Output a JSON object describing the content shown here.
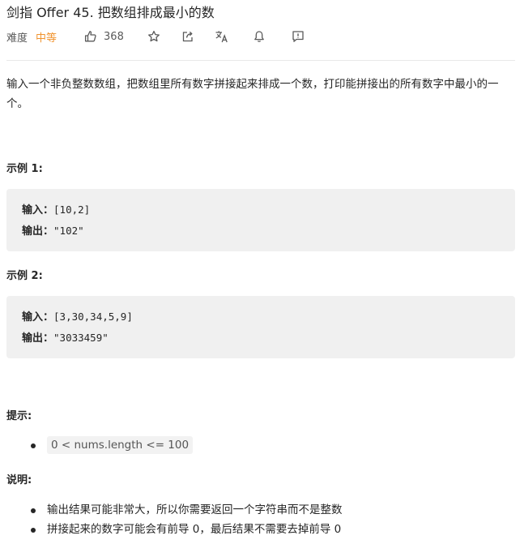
{
  "problem": {
    "title": "剑指 Offer 45. 把数组排成最小的数",
    "difficulty_label": "难度",
    "difficulty": "中等",
    "likes": "368"
  },
  "icons": [
    "thumbs-up-icon",
    "star-icon",
    "share-icon",
    "translate-icon",
    "bell-icon",
    "feedback-icon"
  ],
  "colors": {
    "difficulty": "#f0932e",
    "code_bg": "#f0f0f0"
  },
  "description": "输入一个非负整数数组，把数组里所有数字拼接起来排成一个数，打印能拼接出的所有数字中最小的一个。",
  "examples": [
    {
      "heading": "示例 1:",
      "input_label": "输入：",
      "input_value": "[10,2]",
      "output_label": "输出：",
      "output_value": "\"102\""
    },
    {
      "heading": "示例 2:",
      "input_label": "输入：",
      "input_value": "[3,30,34,5,9]",
      "output_label": "输出：",
      "output_value": "\"3033459\""
    }
  ],
  "hints": {
    "heading": "提示:",
    "items": [
      "0 < nums.length <= 100"
    ]
  },
  "notes": {
    "heading": "说明:",
    "items": [
      "输出结果可能非常大，所以你需要返回一个字符串而不是整数",
      "拼接起来的数字可能会有前导 0，最后结果不需要去掉前导 0"
    ]
  }
}
